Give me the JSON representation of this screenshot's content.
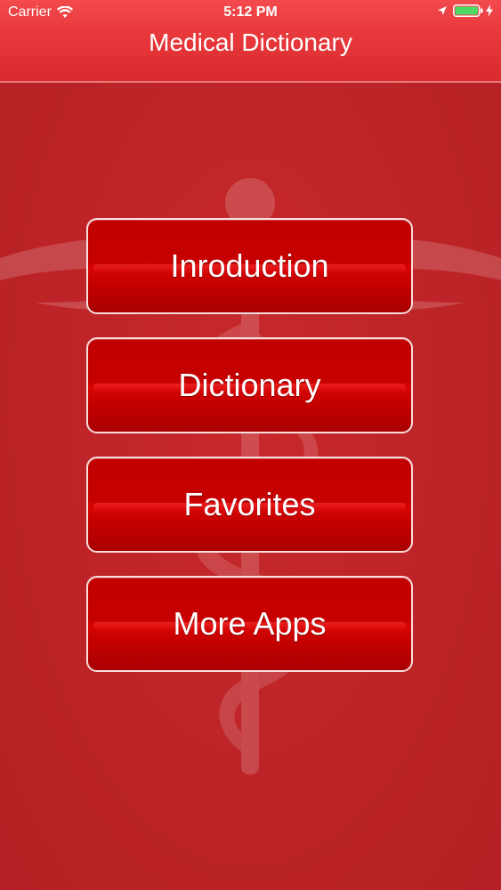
{
  "status_bar": {
    "carrier": "Carrier",
    "time": "5:12 PM",
    "icons": [
      "wifi-icon",
      "location-icon",
      "battery-icon",
      "charging-bolt-icon"
    ]
  },
  "nav_bar": {
    "title": "Medical Dictionary"
  },
  "background": {
    "icon": "caduceus-icon"
  },
  "menu": {
    "items": [
      {
        "label": "Inroduction"
      },
      {
        "label": "Dictionary"
      },
      {
        "label": "Favorites"
      },
      {
        "label": "More Apps"
      }
    ]
  },
  "colors": {
    "background": "#c0282b",
    "nav_bar": "#e8393c",
    "button": "#c10000",
    "button_border": "#f6dede",
    "text": "#ffffff",
    "battery_fill": "#4cd964"
  }
}
